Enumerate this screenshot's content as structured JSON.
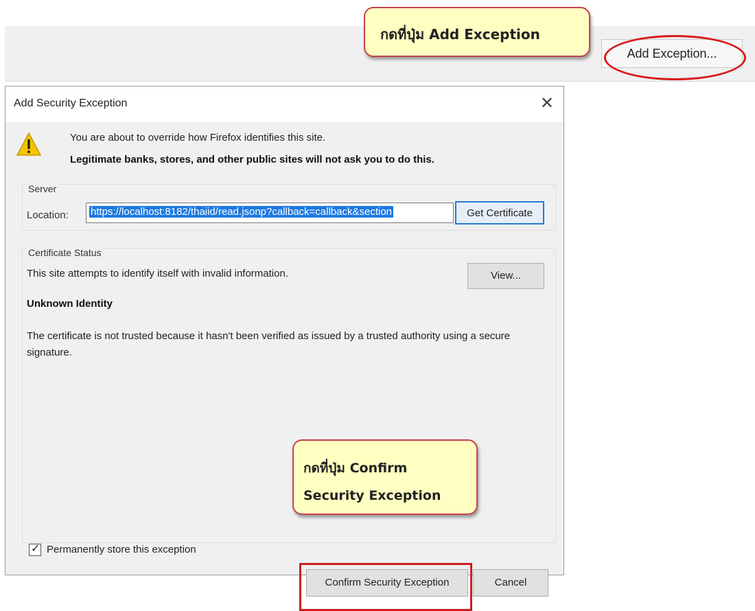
{
  "top": {
    "add_exception_button": "Add Exception..."
  },
  "callouts": {
    "top_text": "กดที่ปุ่ม Add Exception",
    "bottom_line1": "กดที่ปุ่ม Confirm",
    "bottom_line2": "Security Exception"
  },
  "dialog": {
    "title": "Add Security Exception",
    "close_glyph": "✕",
    "intro_line": "You are about to override how Firefox identifies this site.",
    "intro_bold": "Legitimate banks, stores, and other public sites will not ask you to do this.",
    "server": {
      "group_label": "Server",
      "location_label": "Location:",
      "location_value": "https://localhost:8182/thaiid/read.jsonp?callback=callback&section",
      "get_certificate_button": "Get Certificate"
    },
    "status": {
      "group_label": "Certificate Status",
      "status_line": "This site attempts to identify itself with invalid information.",
      "view_button": "View...",
      "unknown_identity": "Unknown Identity",
      "description": "The certificate is not trusted because it hasn't been verified as issued by a trusted authority using a secure signature."
    },
    "permanent": {
      "checked": true,
      "label": "Permanently store this exception"
    },
    "confirm_button": "Confirm Security Exception",
    "cancel_button": "Cancel"
  },
  "icons": {
    "warning": "warning-icon",
    "close": "close-icon",
    "checkmark": "checkmark-icon"
  },
  "colors": {
    "annotation_red": "#d71c1c",
    "callout_fill": "#ffffc2",
    "selection_blue": "#1e7ae0"
  }
}
